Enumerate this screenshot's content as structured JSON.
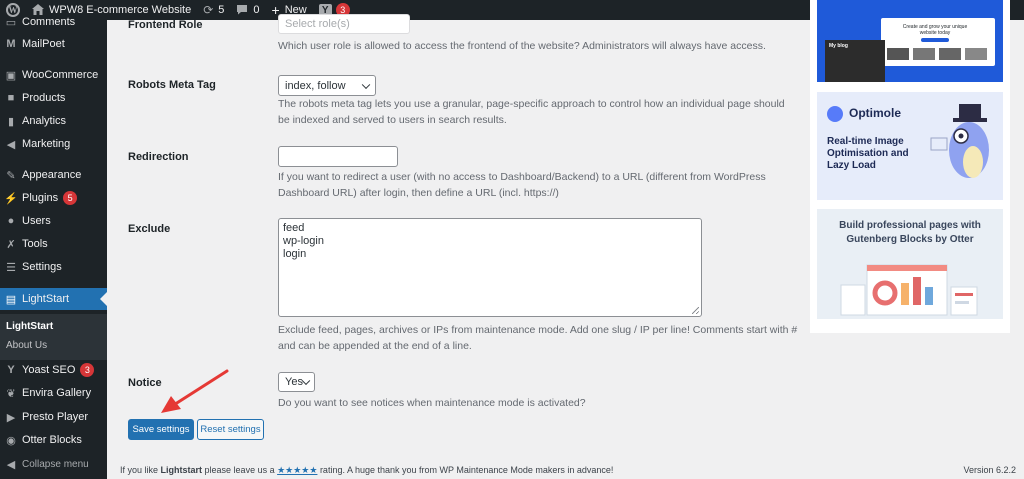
{
  "admin_bar": {
    "site_name": "WPW8 E-commerce Website",
    "updates_count": "5",
    "comments_count": "0",
    "new_label": "New",
    "yoast_count": "3"
  },
  "sidebar": {
    "items": [
      {
        "label": "Comments"
      },
      {
        "label": "MailPoet"
      },
      {
        "label": "WooCommerce"
      },
      {
        "label": "Products"
      },
      {
        "label": "Analytics"
      },
      {
        "label": "Marketing"
      },
      {
        "label": "Appearance"
      },
      {
        "label": "Plugins",
        "badge": "5"
      },
      {
        "label": "Users"
      },
      {
        "label": "Tools"
      },
      {
        "label": "Settings"
      },
      {
        "label": "LightStart"
      },
      {
        "label": "Yoast SEO",
        "badge": "3"
      },
      {
        "label": "Envira Gallery"
      },
      {
        "label": "Presto Player"
      },
      {
        "label": "Otter Blocks"
      },
      {
        "label": "Collapse menu"
      }
    ],
    "submenu": [
      {
        "label": "LightStart"
      },
      {
        "label": "About Us"
      }
    ]
  },
  "form": {
    "frontend_role": {
      "label": "Frontend Role",
      "placeholder": "Select role(s)",
      "description": "Which user role is allowed to access the frontend of the website? Administrators will always have access."
    },
    "robots": {
      "label": "Robots Meta Tag",
      "value": "index, follow",
      "description": "The robots meta tag lets you use a granular, page-specific approach to control how an individual page should be indexed and served to users in search results."
    },
    "redirection": {
      "label": "Redirection",
      "value": "",
      "description": "If you want to redirect a user (with no access to Dashboard/Backend) to a URL (different from WordPress Dashboard URL) after login, then define a URL (incl. https://)"
    },
    "exclude": {
      "label": "Exclude",
      "lines": [
        "feed",
        "wp-login",
        "login"
      ],
      "description": "Exclude feed, pages, archives or IPs from maintenance mode. Add one slug / IP per line! Comments start with # and can be appended at the end of a line."
    },
    "notice": {
      "label": "Notice",
      "value": "Yes",
      "description": "Do you want to see notices when maintenance mode is activated?"
    },
    "save_label": "Save settings",
    "reset_label": "Reset settings"
  },
  "footer": {
    "text_before": "If you like ",
    "plugin_name": "Lightstart",
    "text_middle": " please leave us a ",
    "stars": "★★★★★",
    "text_after": " rating. A huge thank you from WP Maintenance Mode makers in advance!",
    "version": "Version 6.2.2"
  },
  "ads": {
    "ad1": {
      "headline": "Create and grow your unique website today",
      "brand": "My blog"
    },
    "ad2": {
      "brand": "Optimole",
      "tagline": "Real-time Image Optimisation and Lazy Load"
    },
    "ad3": {
      "tagline": "Build professional pages with Gutenberg Blocks by Otter"
    }
  },
  "colors": {
    "admin_dark": "#1d2327",
    "accent": "#2271b1",
    "badge_red": "#d63638",
    "arrow_red": "#e53935"
  }
}
